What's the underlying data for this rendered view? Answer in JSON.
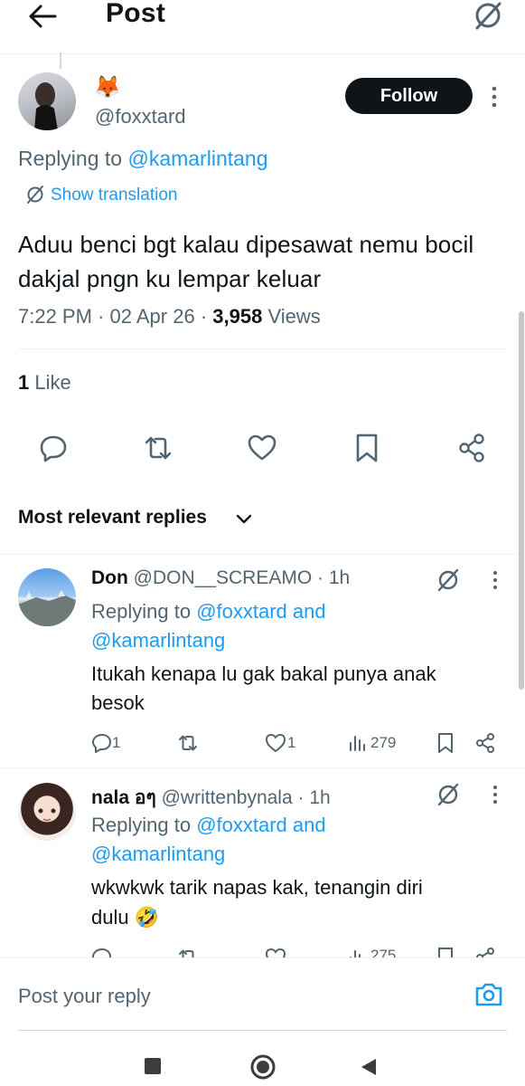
{
  "header": {
    "title": "Post"
  },
  "main_post": {
    "emoji": "🦊",
    "handle": "@foxxtard",
    "follow_label": "Follow",
    "replying_prefix": "Replying to",
    "replying_to": "@kamarlintang",
    "show_translation": "Show translation",
    "text": "Aduu benci bgt kalau dipesawat nemu bocil dakjal pngn ku lempar keluar",
    "time": "7:22 PM",
    "date": "02 Apr 26",
    "views_count": "3,958",
    "views_label": "Views",
    "like_count": "1",
    "like_label": "Like",
    "sep": "·"
  },
  "replies_section": {
    "sort_label": "Most relevant replies"
  },
  "replies": [
    {
      "name": "Don",
      "handle": "@DON__SCREAMO",
      "time": "· 1h",
      "replying_prefix": "Replying to",
      "replying_to": "@foxxtard and",
      "replying_to2": "@kamarlintang",
      "text_line1": "Itukah kenapa lu gak bakal punya anak",
      "text_line2": "besok",
      "replies": "1",
      "likes": "1",
      "views": "279"
    },
    {
      "name": "nala อๆ",
      "handle": "@writtenbynala",
      "time": "· 1h",
      "replying_prefix": "Replying to",
      "replying_to": "@foxxtard and",
      "replying_to2": "@kamarlintang",
      "text_line1": "wkwkwk tarik napas kak, tenangin diri",
      "text_line2": "dulu 🤣",
      "views": "275"
    }
  ],
  "composer": {
    "placeholder": "Post your reply"
  },
  "colors": {
    "accent": "#1d9bf0",
    "text": "#0f1419",
    "muted": "#536471",
    "follow_bg": "#0f1419"
  }
}
